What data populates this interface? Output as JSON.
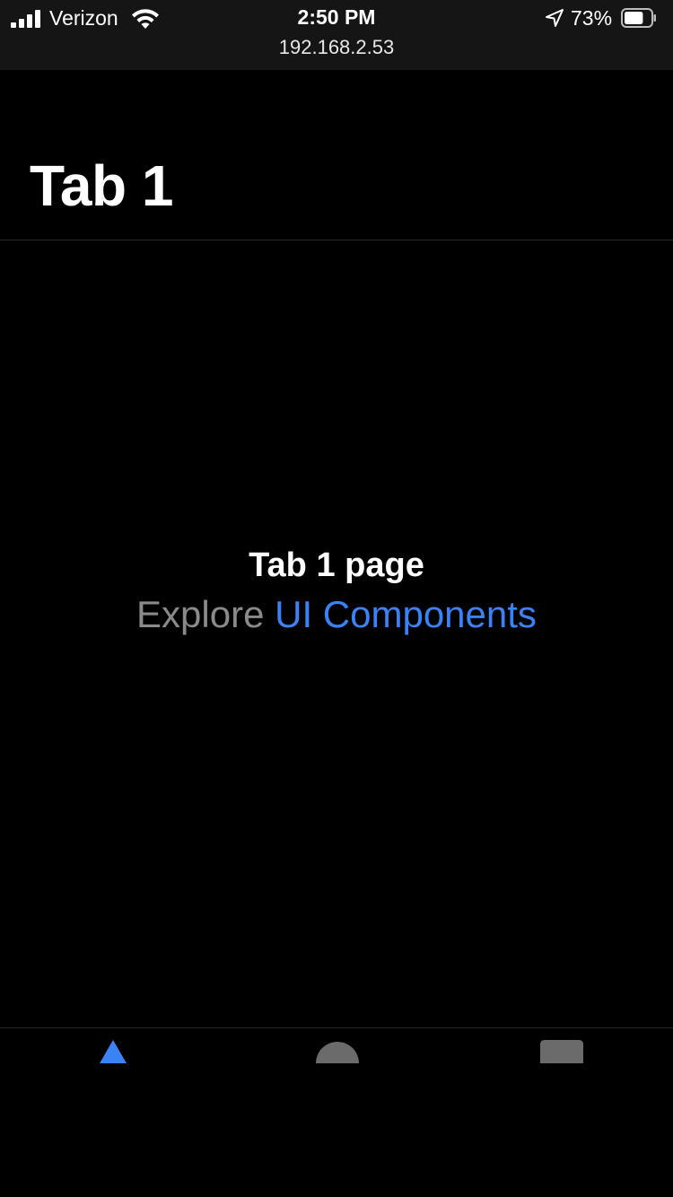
{
  "status_bar": {
    "carrier": "Verizon",
    "time": "2:50 PM",
    "url": "192.168.2.53",
    "battery_percent": "73%",
    "battery_level": 0.73,
    "signal_bars": 4,
    "icons": [
      "signal-icon",
      "wifi-icon",
      "location-arrow-icon",
      "battery-icon"
    ]
  },
  "header": {
    "title": "Tab 1"
  },
  "main": {
    "heading": "Tab 1 page",
    "explore_text": "Explore",
    "explore_link": "UI Components"
  },
  "tab_bar": {
    "tabs": [
      {
        "icon": "triangle-icon",
        "active": true
      },
      {
        "icon": "ellipse-icon",
        "active": false
      },
      {
        "icon": "square-icon",
        "active": false
      }
    ],
    "colors": {
      "active": "#3b82f6",
      "inactive": "#6b6b6b"
    }
  },
  "colors": {
    "background": "#000000",
    "status_bar": "#151515",
    "link": "#3b82f6",
    "muted_text": "#8a8a8a"
  }
}
